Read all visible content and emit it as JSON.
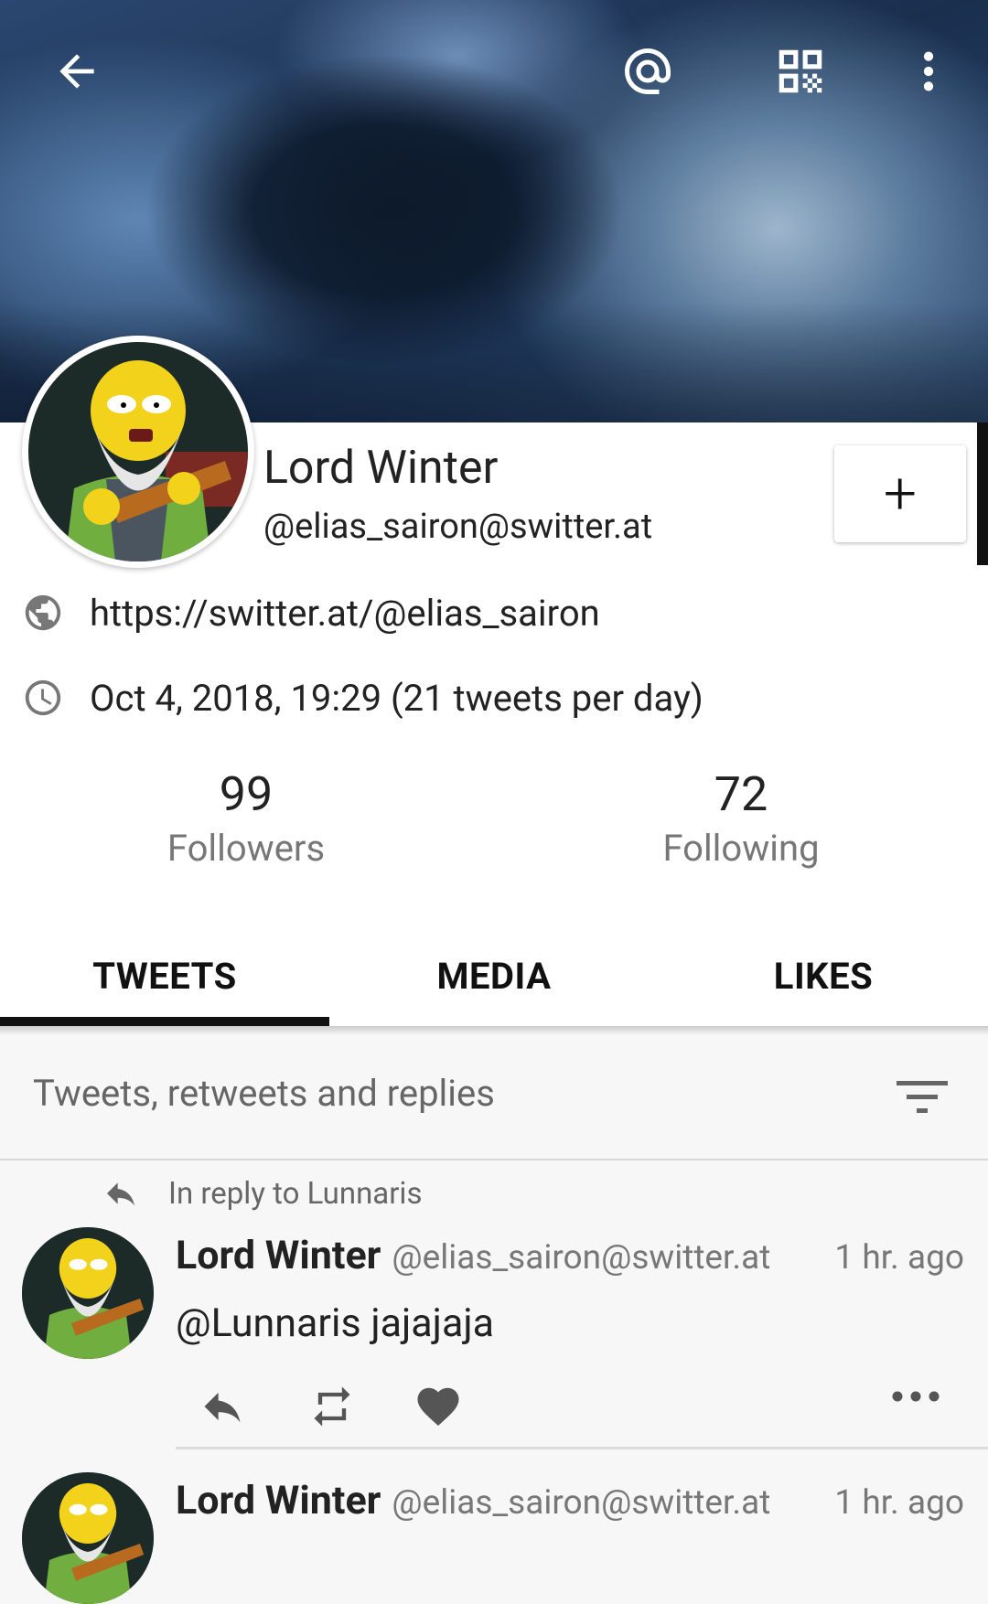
{
  "toolbar": {
    "back_icon": "arrow-back-icon",
    "mention_icon": "at-sign-icon",
    "qr_icon": "qr-code-icon",
    "more_icon": "more-vertical-icon"
  },
  "profile": {
    "display_name": "Lord Winter",
    "handle": "@elias_sairon@switter.at",
    "url": "https://switter.at/@elias_sairon",
    "joined": "Oct 4, 2018, 19:29 (21 tweets per day)",
    "follow_button": "+",
    "followers_count": "99",
    "followers_label": "Followers",
    "following_count": "72",
    "following_label": "Following"
  },
  "tabs": [
    {
      "label": "TWEETS",
      "active": true
    },
    {
      "label": "MEDIA",
      "active": false
    },
    {
      "label": "LIKES",
      "active": false
    }
  ],
  "filter": {
    "label": "Tweets, retweets and replies"
  },
  "tweets": [
    {
      "reply_note": "In reply to Lunnaris",
      "name": "Lord Winter",
      "handle": "@elias_sairon@switter.at",
      "time": "1 hr. ago",
      "body": "@Lunnaris jajajaja"
    },
    {
      "name": "Lord Winter",
      "handle": "@elias_sairon@switter.at",
      "time": "1 hr. ago"
    }
  ],
  "colors": {
    "accent": "#111111",
    "muted_text": "#777777",
    "background": "#f7f7f7"
  }
}
